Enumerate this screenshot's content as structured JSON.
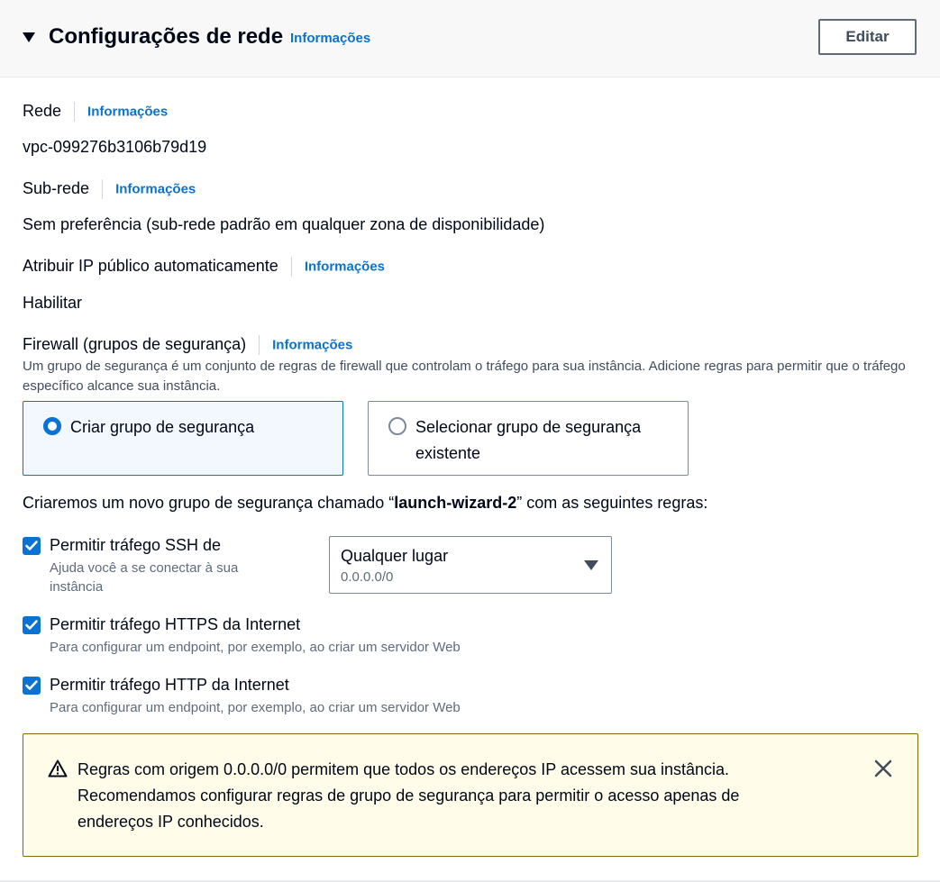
{
  "header": {
    "title": "Configurações de rede",
    "info_label": "Informações",
    "edit_label": "Editar"
  },
  "network": {
    "label": "Rede",
    "info_label": "Informações",
    "value": "vpc-099276b3106b79d19"
  },
  "subnet": {
    "label": "Sub-rede",
    "info_label": "Informações",
    "value": "Sem preferência (sub-rede padrão em qualquer zona de disponibilidade)"
  },
  "public_ip": {
    "label": "Atribuir IP público automaticamente",
    "info_label": "Informações",
    "value": "Habilitar"
  },
  "firewall": {
    "label": "Firewall (grupos de segurança)",
    "info_label": "Informações",
    "description": "Um grupo de segurança é um conjunto de regras de firewall que controlam o tráfego para sua instância. Adicione regras para permitir que o tráfego específico alcance sua instância.",
    "options": [
      {
        "label": "Criar grupo de segurança",
        "selected": true
      },
      {
        "label": "Selecionar grupo de segurança existente",
        "selected": false
      }
    ]
  },
  "rules": {
    "intro_prefix": "Criaremos um novo grupo de segurança chamado “",
    "group_name": "launch-wizard-2",
    "intro_suffix": "” com as seguintes regras:",
    "ssh": {
      "label": "Permitir tráfego SSH de",
      "description": "Ajuda você a se conectar à sua instância",
      "checked": true,
      "source": {
        "selected": "Qualquer lugar",
        "sub": "0.0.0.0/0"
      }
    },
    "https": {
      "label": "Permitir tráfego HTTPS da Internet",
      "description": "Para configurar um endpoint, por exemplo, ao criar um servidor Web",
      "checked": true
    },
    "http": {
      "label": "Permitir tráfego HTTP da Internet",
      "description": "Para configurar um endpoint, por exemplo, ao criar um servidor Web",
      "checked": true
    }
  },
  "warning": {
    "text": "Regras com origem 0.0.0.0/0 permitem que todos os endereços IP acessem sua instância. Recomendamos configurar regras de grupo de segurança para permitir o acesso apenas de endereços IP conhecidos.",
    "icon": "warning-icon"
  },
  "colors": {
    "link": "#0972d3",
    "warning_border": "#8d6605",
    "warning_bg": "#fffce9",
    "selected_bg": "#f2f8fd"
  }
}
